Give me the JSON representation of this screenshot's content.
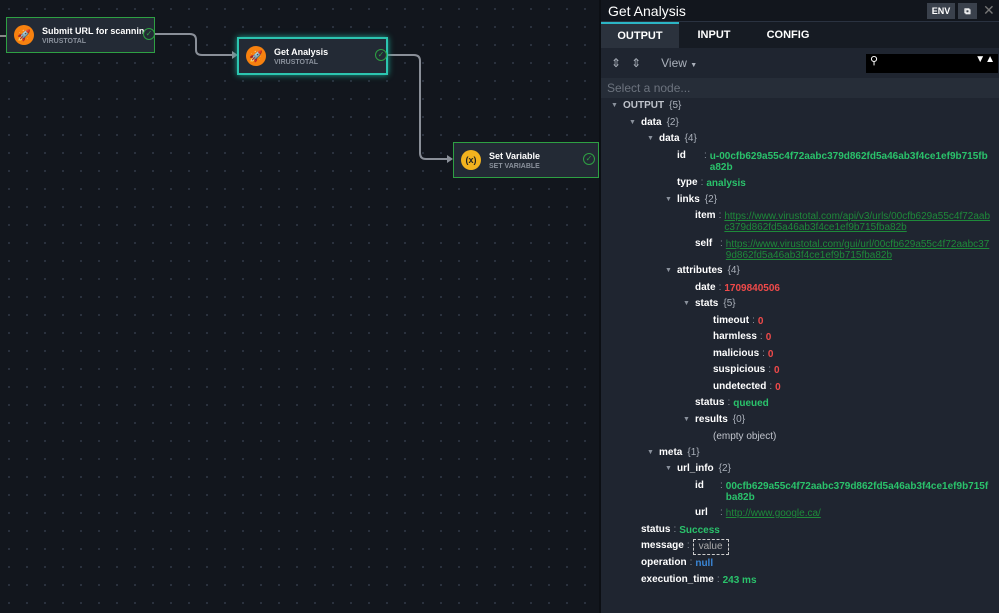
{
  "nodes": [
    {
      "title": "Submit URL for scanning",
      "subtitle": "VIRUSTOTAL",
      "icon": "rocket-icon"
    },
    {
      "title": "Get Analysis",
      "subtitle": "VIRUSTOTAL",
      "icon": "rocket-icon"
    },
    {
      "title": "Set Variable",
      "subtitle": "SET VARIABLE",
      "icon": "variable-icon",
      "glyph": "(x)"
    }
  ],
  "panel": {
    "title": "Get Analysis",
    "env_label": "ENV",
    "tabs": [
      "OUTPUT",
      "INPUT",
      "CONFIG"
    ],
    "active_tab": "OUTPUT",
    "view_label": "View",
    "select_placeholder": "Select a node..."
  },
  "colors": {
    "success": "#2ea043",
    "selected": "#2cc5b0",
    "string": "#2ac26b",
    "number": "#f04a4a"
  },
  "tree": [
    {
      "level": 0,
      "key": "OUTPUT",
      "count": "{5}",
      "expand": true
    },
    {
      "level": 1,
      "key": "data",
      "count": "{2}",
      "expand": true
    },
    {
      "level": 2,
      "key": "data",
      "count": "{4}",
      "expand": true
    },
    {
      "level": 3,
      "key": "id",
      "value": "u-00cfb629a55c4f72aabc379d862fd5a46ab3f4ce1ef9b715fba82b",
      "type": "str",
      "pad": true
    },
    {
      "level": 3,
      "key": "type",
      "value": "analysis",
      "type": "str"
    },
    {
      "level": 3,
      "key": "links",
      "count": "{2}",
      "expand": true
    },
    {
      "level": 4,
      "key": "item",
      "value": "https://www.virustotal.com/api/v3/urls/00cfb629a55c4f72aabc379d862fd5a46ab3f4ce1ef9b715fba82b",
      "type": "link"
    },
    {
      "level": 4,
      "key": "self",
      "value": "https://www.virustotal.com/gui/url/00cfb629a55c4f72aabc379d862fd5a46ab3f4ce1ef9b715fba82b",
      "type": "link",
      "pad": true
    },
    {
      "level": 3,
      "key": "attributes",
      "count": "{4}",
      "expand": true
    },
    {
      "level": 4,
      "key": "date",
      "value": "1709840506",
      "type": "num"
    },
    {
      "level": 4,
      "key": "stats",
      "count": "{5}",
      "expand": true
    },
    {
      "level": 5,
      "key": "timeout",
      "value": "0",
      "type": "num"
    },
    {
      "level": 5,
      "key": "harmless",
      "value": "0",
      "type": "num"
    },
    {
      "level": 5,
      "key": "malicious",
      "value": "0",
      "type": "num"
    },
    {
      "level": 5,
      "key": "suspicious",
      "value": "0",
      "type": "num"
    },
    {
      "level": 5,
      "key": "undetected",
      "value": "0",
      "type": "num"
    },
    {
      "level": 4,
      "key": "status",
      "value": "queued",
      "type": "str"
    },
    {
      "level": 4,
      "key": "results",
      "count": "{0}",
      "expand": true
    },
    {
      "level": 5,
      "key": "",
      "value": "(empty object)",
      "type": "muted"
    },
    {
      "level": 2,
      "key": "meta",
      "count": "{1}",
      "expand": true
    },
    {
      "level": 3,
      "key": "url_info",
      "count": "{2}",
      "expand": true
    },
    {
      "level": 4,
      "key": "id",
      "value": "00cfb629a55c4f72aabc379d862fd5a46ab3f4ce1ef9b715fba82b",
      "type": "str",
      "pad": true
    },
    {
      "level": 4,
      "key": "url",
      "value": "http://www.google.ca/",
      "type": "link",
      "pad": true
    },
    {
      "level": 1,
      "key": "status",
      "value": "Success",
      "type": "str"
    },
    {
      "level": 1,
      "key": "message",
      "value": "value",
      "type": "box"
    },
    {
      "level": 1,
      "key": "operation",
      "value": "null",
      "type": "null"
    },
    {
      "level": 1,
      "key": "execution_time",
      "value": "243 ms",
      "type": "str"
    }
  ]
}
